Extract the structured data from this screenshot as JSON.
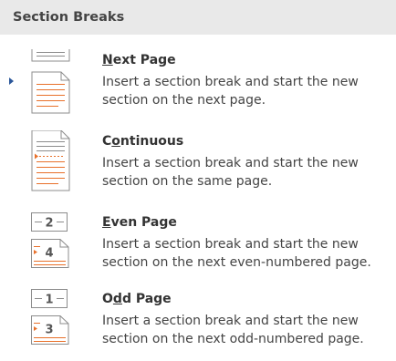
{
  "menu": {
    "header": "Section Breaks",
    "items": [
      {
        "title_access_key": "N",
        "title_rest": "ext Page",
        "description": "Insert a section break and start the new section on the next page.",
        "icon": "next-page-break-icon"
      },
      {
        "title_prefix": "C",
        "title_access_key": "o",
        "title_rest": "ntinuous",
        "description": "Insert a section break and start the new section on the same page.",
        "icon": "continuous-break-icon"
      },
      {
        "title_access_key": "E",
        "title_rest": "ven Page",
        "description": "Insert a section break and start the new section on the next even-numbered page.",
        "icon": "even-page-break-icon",
        "icon_numbers": [
          "2",
          "4"
        ]
      },
      {
        "title_prefix": "O",
        "title_access_key": "d",
        "title_rest": "d Page",
        "description": "Insert a section break and start the new section on the next odd-numbered page.",
        "icon": "odd-page-break-icon",
        "icon_numbers": [
          "1",
          "3"
        ]
      }
    ]
  },
  "colors": {
    "accent_orange": "#e8702a",
    "selection_marker": "#2b579a",
    "header_bg": "#e9e9e9"
  }
}
